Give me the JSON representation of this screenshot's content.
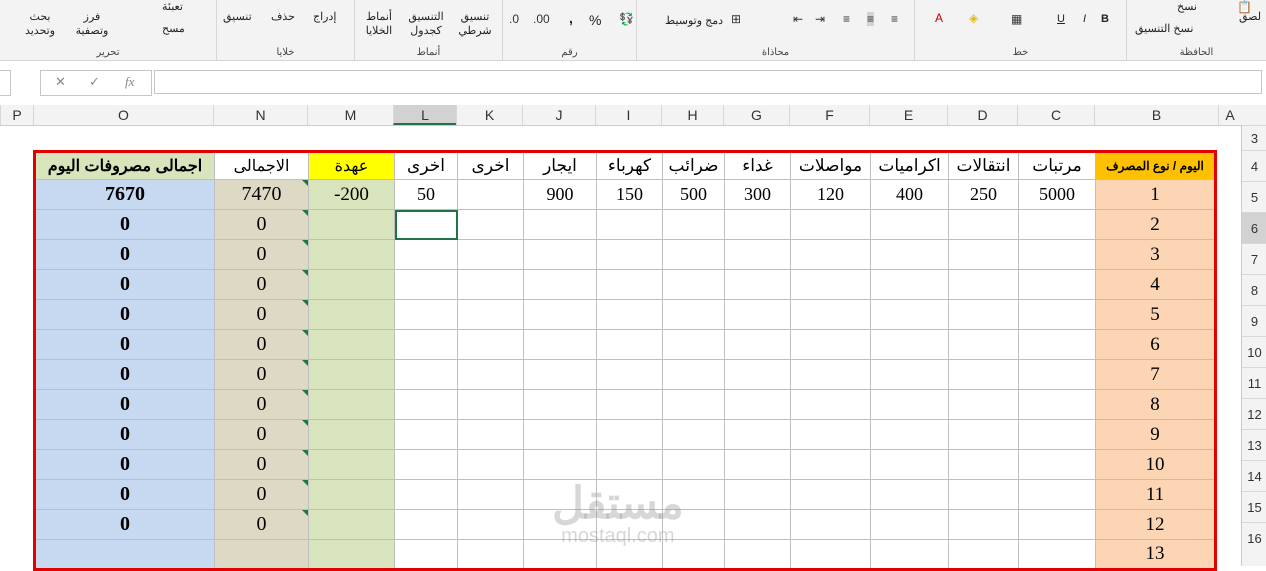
{
  "ribbon": {
    "clipboard": {
      "label": "الحافظة",
      "paste": "لصق",
      "copy": "نسخ",
      "format_painter": "نسخ التنسيق"
    },
    "font": {
      "label": "خط",
      "bold": "B",
      "italic": "I",
      "underline": "U"
    },
    "alignment": {
      "label": "محاذاة",
      "merge": "دمج وتوسيط"
    },
    "number": {
      "label": "رقم",
      "percent": "%",
      "comma": ","
    },
    "styles": {
      "label": "أنماط",
      "conditional": "تنسيق شرطي",
      "as_table": "التنسيق كجدول",
      "cell_styles": "أنماط الخلايا"
    },
    "cells": {
      "label": "خلايا",
      "insert": "إدراج",
      "delete": "حذف",
      "format": "تنسيق"
    },
    "editing": {
      "label": "تحرير",
      "fill": "تعبئة",
      "clear": "مسح",
      "sort": "فرز وتصفية",
      "find": "بحث وتحديد"
    }
  },
  "formula_bar": {
    "fx": "fx",
    "cancel": "✕",
    "enter": "✓",
    "value": ""
  },
  "columns": [
    "A",
    "B",
    "C",
    "D",
    "E",
    "F",
    "G",
    "H",
    "I",
    "J",
    "K",
    "L",
    "M",
    "N",
    "O",
    "P"
  ],
  "rows": [
    "3",
    "4",
    "5",
    "6",
    "7",
    "8",
    "9",
    "10",
    "11",
    "12",
    "13",
    "14",
    "15",
    "16"
  ],
  "selected_column": "L",
  "selected_row": "6",
  "sheet": {
    "headers": [
      "اجمالى مصروفات اليوم",
      "الاجمالى",
      "عهدة",
      "اخرى",
      "اخرى",
      "ايجار",
      "كهرباء",
      "ضرائب",
      "غداء",
      "مواصلات",
      "اكراميات",
      "انتقالات",
      "مرتبات",
      "اليوم / نوع المصرف"
    ],
    "data_rows": [
      [
        "7670",
        "7470",
        "-200",
        "50",
        "",
        "900",
        "150",
        "500",
        "300",
        "120",
        "400",
        "250",
        "5000",
        "1"
      ],
      [
        "0",
        "0",
        "",
        "",
        "",
        "",
        "",
        "",
        "",
        "",
        "",
        "",
        "",
        "2"
      ],
      [
        "0",
        "0",
        "",
        "",
        "",
        "",
        "",
        "",
        "",
        "",
        "",
        "",
        "",
        "3"
      ],
      [
        "0",
        "0",
        "",
        "",
        "",
        "",
        "",
        "",
        "",
        "",
        "",
        "",
        "",
        "4"
      ],
      [
        "0",
        "0",
        "",
        "",
        "",
        "",
        "",
        "",
        "",
        "",
        "",
        "",
        "",
        "5"
      ],
      [
        "0",
        "0",
        "",
        "",
        "",
        "",
        "",
        "",
        "",
        "",
        "",
        "",
        "",
        "6"
      ],
      [
        "0",
        "0",
        "",
        "",
        "",
        "",
        "",
        "",
        "",
        "",
        "",
        "",
        "",
        "7"
      ],
      [
        "0",
        "0",
        "",
        "",
        "",
        "",
        "",
        "",
        "",
        "",
        "",
        "",
        "",
        "8"
      ],
      [
        "0",
        "0",
        "",
        "",
        "",
        "",
        "",
        "",
        "",
        "",
        "",
        "",
        "",
        "9"
      ],
      [
        "0",
        "0",
        "",
        "",
        "",
        "",
        "",
        "",
        "",
        "",
        "",
        "",
        "",
        "10"
      ],
      [
        "0",
        "0",
        "",
        "",
        "",
        "",
        "",
        "",
        "",
        "",
        "",
        "",
        "",
        "11"
      ],
      [
        "0",
        "0",
        "",
        "",
        "",
        "",
        "",
        "",
        "",
        "",
        "",
        "",
        "",
        "12"
      ],
      [
        "",
        "",
        "",
        "",
        "",
        "",
        "",
        "",
        "",
        "",
        "",
        "",
        "",
        "13"
      ]
    ]
  },
  "watermark": {
    "arabic": "مستقل",
    "latin": "mostaql.com"
  }
}
